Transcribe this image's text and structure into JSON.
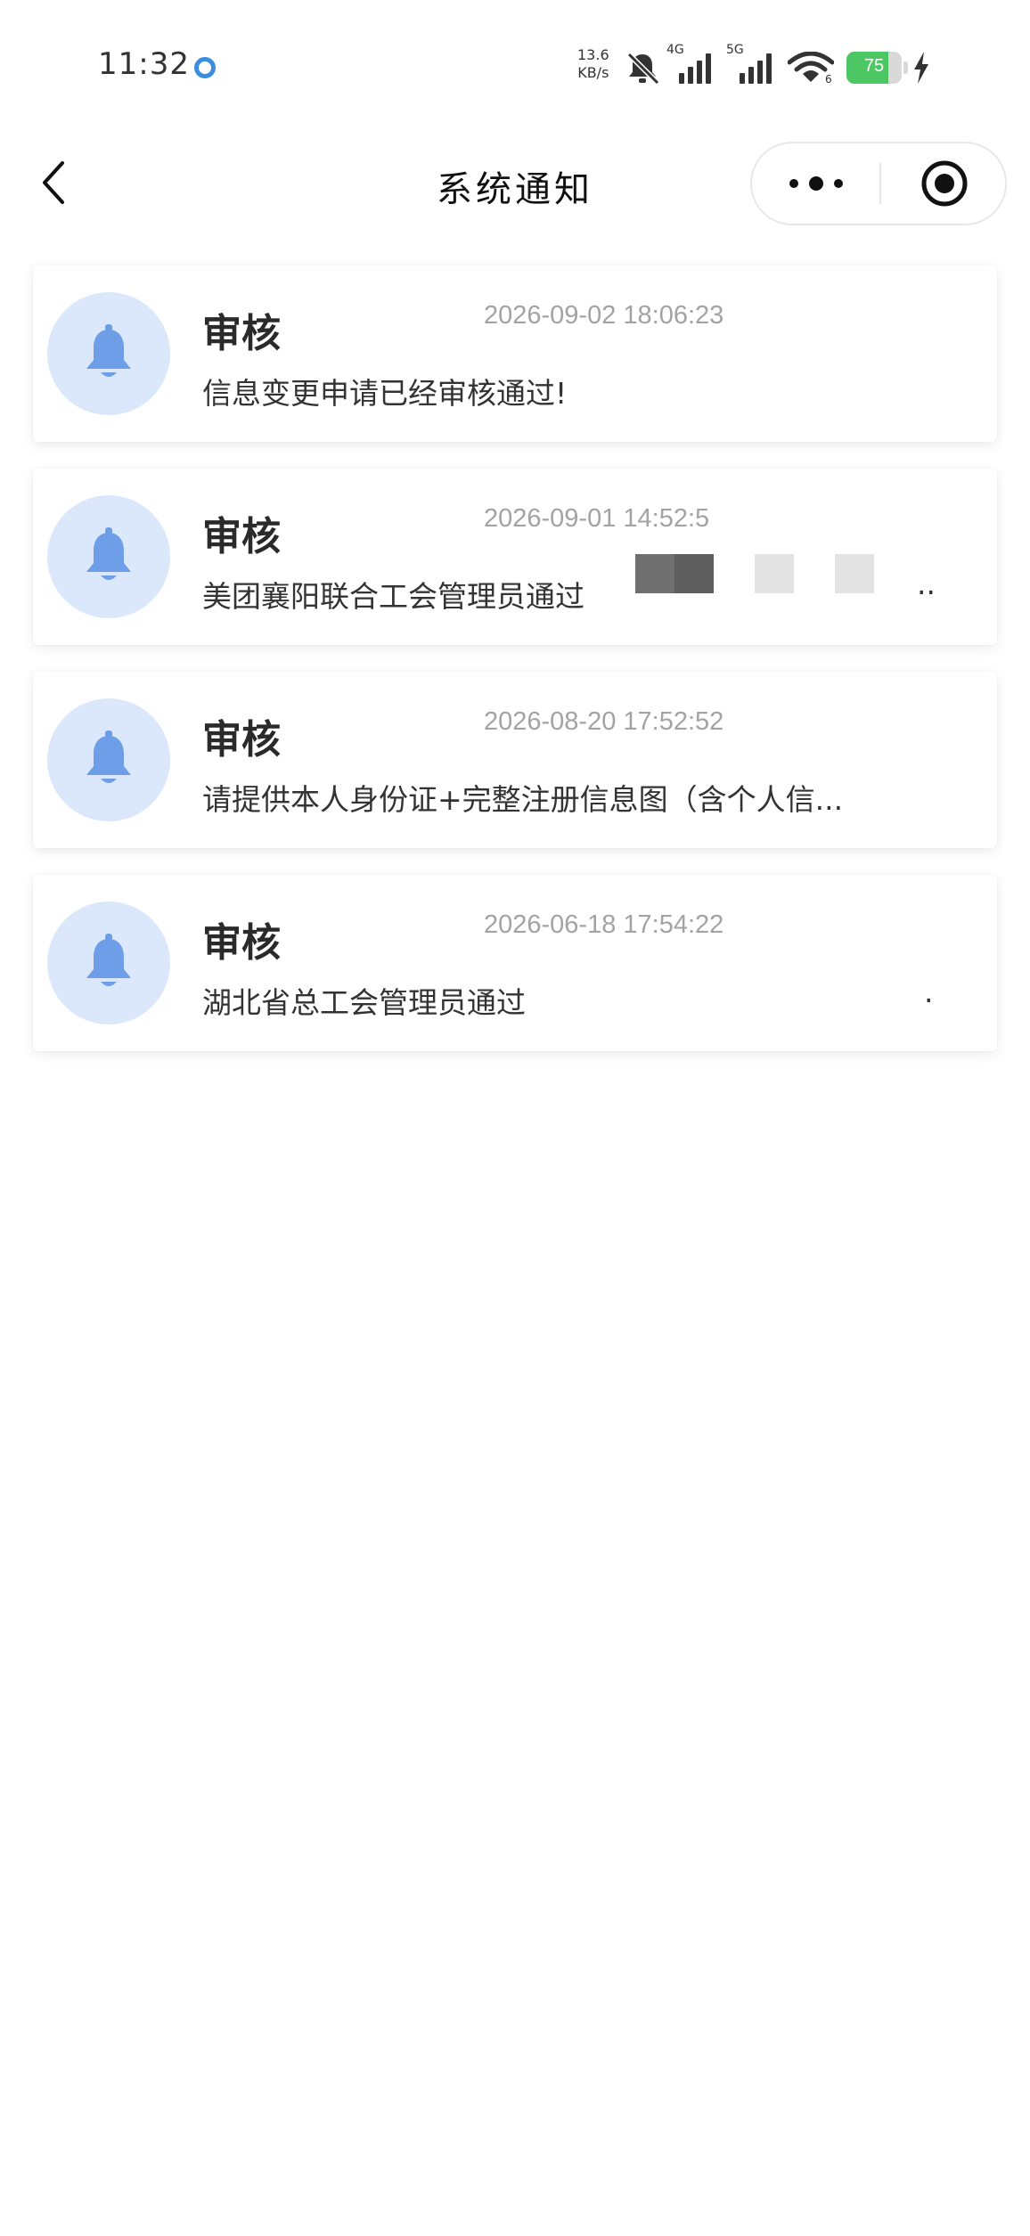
{
  "status_bar": {
    "time": "11:32",
    "speed_value": "13.6",
    "speed_unit": "KB/s",
    "net_4g": "4G",
    "net_5g": "5G",
    "wifi_badge": "6",
    "battery_level": 75,
    "battery_text": "75",
    "battery_color": "#4cc764",
    "accent_ring_color": "#3b8de0"
  },
  "nav": {
    "title": "系统通知",
    "back_icon": "chevron-left-icon",
    "more_icon": "more-dots-icon",
    "close_icon": "target-circle-icon"
  },
  "notifications": [
    {
      "title": "审核",
      "time": "2026-09-02 18:06:23",
      "body": "信息变更申请已经审核通过!",
      "icon": "bell-icon"
    },
    {
      "title": "审核",
      "time": "2026-09-01 14:52:5",
      "body": "美团襄阳联合工会管理员通过",
      "body_tail": "..",
      "icon": "bell-icon"
    },
    {
      "title": "审核",
      "time": "2026-08-20 17:52:52",
      "body": "请提供本人身份证+完整注册信息图（含个人信...",
      "icon": "bell-icon"
    },
    {
      "title": "审核",
      "time": "2026-06-18 17:54:22",
      "body": "湖北省总工会管理员通过",
      "body_tail": ".",
      "icon": "bell-icon"
    }
  ],
  "colors": {
    "bell": "#6e9ee8",
    "bell_bg": "#dbe8fb",
    "time_text": "#a3a3a3"
  }
}
